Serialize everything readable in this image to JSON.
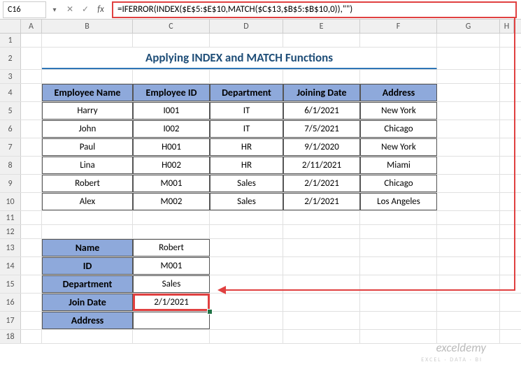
{
  "app": {
    "active_cell": "C16",
    "formula": "=IFERROR(INDEX($E$5:$E$10,MATCH($C$13,$B$5:$B$10,0)),\"\")"
  },
  "columns": [
    "A",
    "B",
    "C",
    "D",
    "E",
    "F",
    "G",
    "H"
  ],
  "rows": [
    "1",
    "2",
    "3",
    "4",
    "5",
    "6",
    "7",
    "8",
    "9",
    "10",
    "11",
    "12",
    "13",
    "14",
    "15",
    "16",
    "17",
    "18"
  ],
  "title": "Applying INDEX and MATCH Functions",
  "table": {
    "headers": [
      "Employee Name",
      "Employee ID",
      "Department",
      "Joining Date",
      "Address"
    ],
    "rows": [
      [
        "Harry",
        "I001",
        "IT",
        "6/1/2021",
        "New York"
      ],
      [
        "John",
        "I002",
        "IT",
        "7/5/2021",
        "Chicago"
      ],
      [
        "Paul",
        "H001",
        "HR",
        "9/1/2020",
        "New York"
      ],
      [
        "Lina",
        "H002",
        "HR",
        "2/11/2021",
        "Miami"
      ],
      [
        "Robert",
        "M001",
        "Sales",
        "2/1/2021",
        "Chicago"
      ],
      [
        "Alex",
        "M002",
        "Sales",
        "2/1/2021",
        "Los Angeles"
      ]
    ]
  },
  "lookup": {
    "labels": [
      "Name",
      "ID",
      "Department",
      "Join Date",
      "Address"
    ],
    "values": [
      "Robert",
      "M001",
      "Sales",
      "2/1/2021",
      ""
    ]
  },
  "watermark": {
    "main": "exceldemy",
    "sub": "EXCEL · DATA · BI"
  }
}
